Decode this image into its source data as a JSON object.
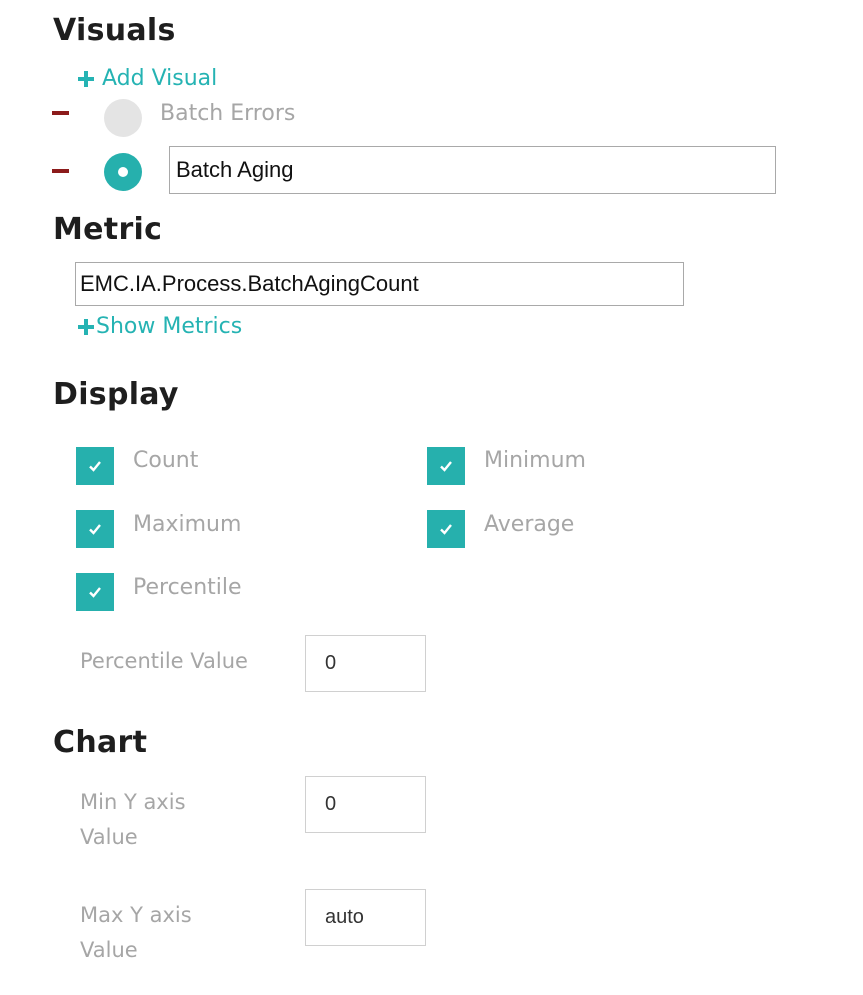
{
  "visuals": {
    "heading": "Visuals",
    "add_label": "Add Visual",
    "items": [
      {
        "label": "Batch Errors",
        "selected": false
      },
      {
        "label": "Batch Aging",
        "selected": true
      }
    ]
  },
  "metric": {
    "heading": "Metric",
    "value": "EMC.IA.Process.BatchAgingCount",
    "show_label": "Show Metrics"
  },
  "display": {
    "heading": "Display",
    "checks": {
      "count": "Count",
      "minimum": "Minimum",
      "maximum": "Maximum",
      "average": "Average",
      "percentile": "Percentile"
    },
    "percentile_value_label": "Percentile Value",
    "percentile_value": "0"
  },
  "chart": {
    "heading": "Chart",
    "min_y_label_1": "Min Y axis",
    "min_y_label_2": "Value",
    "min_y_value": "0",
    "max_y_label_1": "Max Y axis",
    "max_y_label_2": "Value",
    "max_y_value": "auto"
  },
  "colors": {
    "accent": "#26b0ad",
    "remove": "#8c1b1b",
    "muted_text": "#a6a6a6"
  },
  "icons": {
    "add": "plus-icon",
    "remove": "minus-icon",
    "check": "check-icon"
  }
}
